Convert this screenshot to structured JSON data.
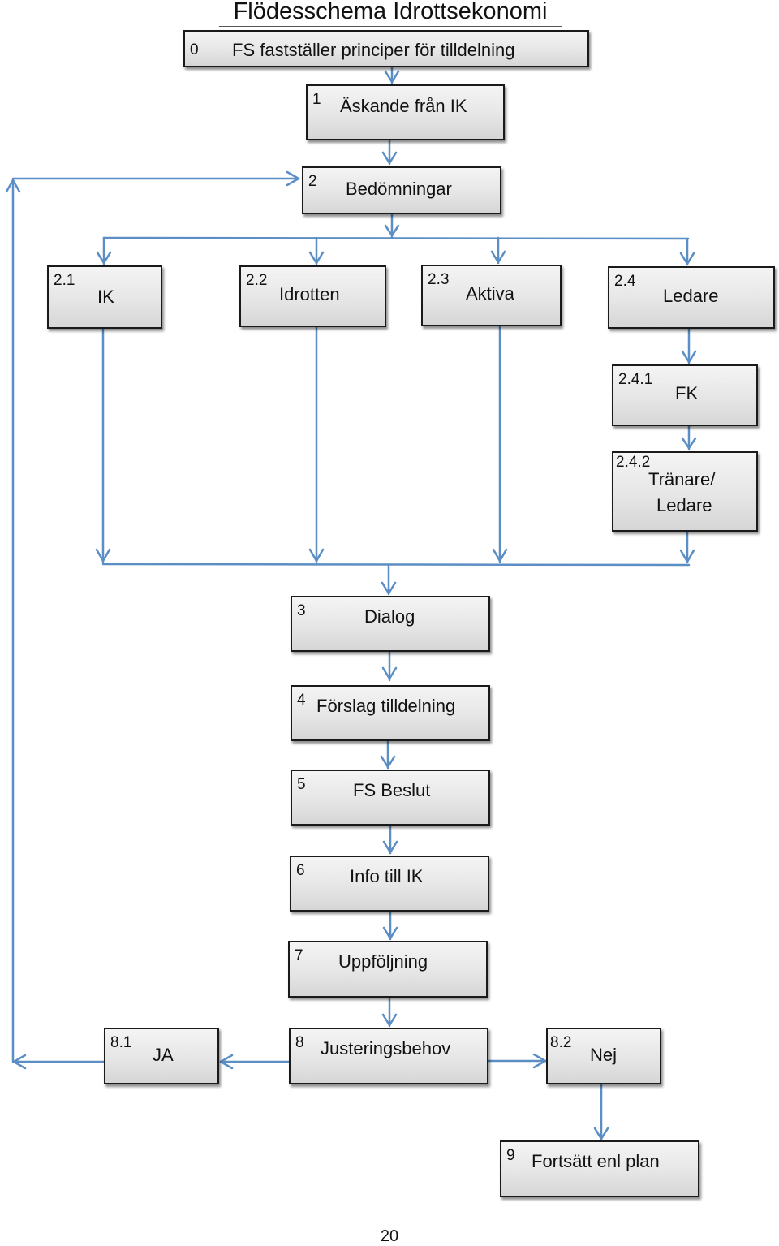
{
  "title": "Flödesschema Idrottsekonomi",
  "page_number": "20",
  "colors": {
    "arrow": "#5b8ec4",
    "box_border": "#1a1a1a",
    "box_fill_top": "#f4f4f4",
    "box_fill_bottom": "#d6d6d6"
  },
  "nodes": {
    "n0": {
      "num": "0",
      "label": "FS fastställer principer för tilldelning"
    },
    "n1": {
      "num": "1",
      "label": "Äskande från IK"
    },
    "n2": {
      "num": "2",
      "label": "Bedömningar"
    },
    "n21": {
      "num": "2.1",
      "label": "IK"
    },
    "n22": {
      "num": "2.2",
      "label": "Idrotten"
    },
    "n23": {
      "num": "2.3",
      "label": "Aktiva"
    },
    "n24": {
      "num": "2.4",
      "label": "Ledare"
    },
    "n241": {
      "num": "2.4.1",
      "label": "FK"
    },
    "n242": {
      "num": "2.4.2",
      "label_line1": "Tränare/",
      "label_line2": "Ledare"
    },
    "n3": {
      "num": "3",
      "label": "Dialog"
    },
    "n4": {
      "num": "4",
      "label": "Förslag tilldelning"
    },
    "n5": {
      "num": "5",
      "label": "FS Beslut"
    },
    "n6": {
      "num": "6",
      "label": "Info till IK"
    },
    "n7": {
      "num": "7",
      "label": "Uppföljning"
    },
    "n8": {
      "num": "8",
      "label": "Justeringsbehov"
    },
    "n81": {
      "num": "8.1",
      "label": "JA"
    },
    "n82": {
      "num": "8.2",
      "label": "Nej"
    },
    "n9": {
      "num": "9",
      "label": "Fortsätt enl plan"
    }
  },
  "edges": [
    [
      "n0",
      "n1"
    ],
    [
      "n1",
      "n2"
    ],
    [
      "n2",
      "n21"
    ],
    [
      "n2",
      "n22"
    ],
    [
      "n2",
      "n23"
    ],
    [
      "n2",
      "n24"
    ],
    [
      "n24",
      "n241"
    ],
    [
      "n241",
      "n242"
    ],
    [
      "n21",
      "n3"
    ],
    [
      "n22",
      "n3"
    ],
    [
      "n23",
      "n3"
    ],
    [
      "n242",
      "n3"
    ],
    [
      "n3",
      "n4"
    ],
    [
      "n4",
      "n5"
    ],
    [
      "n5",
      "n6"
    ],
    [
      "n6",
      "n7"
    ],
    [
      "n7",
      "n8"
    ],
    [
      "n8",
      "n81"
    ],
    [
      "n8",
      "n82"
    ],
    [
      "n82",
      "n9"
    ],
    [
      "n81",
      "n2"
    ]
  ]
}
